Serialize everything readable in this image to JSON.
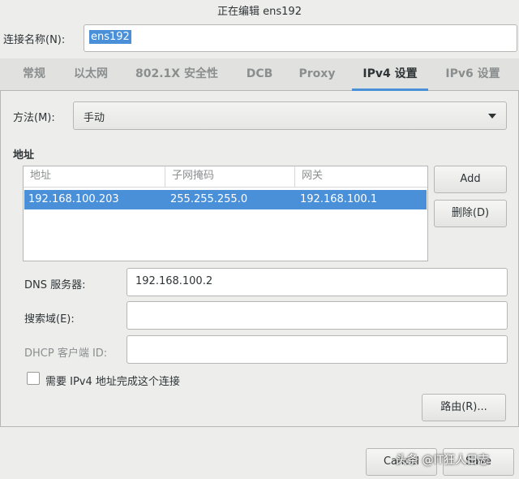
{
  "window": {
    "title": "正在编辑 ens192"
  },
  "connection": {
    "label": "连接名称(N):",
    "value": "ens192"
  },
  "tabs": [
    {
      "label": "常规"
    },
    {
      "label": "以太网"
    },
    {
      "label": "802.1X 安全性"
    },
    {
      "label": "DCB"
    },
    {
      "label": "Proxy"
    },
    {
      "label": "IPv4 设置",
      "active": true
    },
    {
      "label": "IPv6 设置"
    }
  ],
  "method": {
    "label": "方法(M):",
    "value": "手动"
  },
  "address": {
    "heading": "地址",
    "columns": [
      "地址",
      "子网掩码",
      "网关"
    ],
    "rows": [
      [
        "192.168.100.203",
        "255.255.255.0",
        "192.168.100.1"
      ]
    ],
    "add_label": "Add",
    "delete_label": "删除(D)"
  },
  "dns": {
    "label": "DNS 服务器:",
    "value": "192.168.100.2"
  },
  "search": {
    "label": "搜索域(E):",
    "value": ""
  },
  "dhcp": {
    "label": "DHCP 客户端 ID:",
    "value": ""
  },
  "require": {
    "label": "需要 IPv4 地址完成这个连接",
    "checked": false
  },
  "routes_label": "路由(R)...",
  "footer": {
    "cancel_label": "Cancel",
    "save_label": "Save"
  },
  "watermark": "头条 @IT狂人日志",
  "colors": {
    "accent": "#4a90d9",
    "background": "#ededec"
  }
}
